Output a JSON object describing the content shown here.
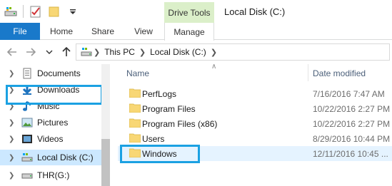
{
  "titlebar": {
    "title": "Local Disk (C:)",
    "context_tab_header": "Drive Tools",
    "qat_icons": [
      "properties-icon",
      "new-folder-icon",
      "customize-qat-icon"
    ]
  },
  "ribbon": {
    "tabs": [
      {
        "label": "File"
      },
      {
        "label": "Home"
      },
      {
        "label": "Share"
      },
      {
        "label": "View"
      },
      {
        "label": "Manage"
      }
    ]
  },
  "address": {
    "breadcrumbs": [
      "This PC",
      "Local Disk (C:)"
    ]
  },
  "sidebar": {
    "items": [
      {
        "label": "Documents",
        "icon": "documents-icon"
      },
      {
        "label": "Downloads",
        "icon": "downloads-icon"
      },
      {
        "label": "Music",
        "icon": "music-icon"
      },
      {
        "label": "Pictures",
        "icon": "pictures-icon"
      },
      {
        "label": "Videos",
        "icon": "videos-icon"
      },
      {
        "label": "Local Disk (C:)",
        "icon": "drive-icon",
        "selected": true
      },
      {
        "label": "THR(G:)",
        "icon": "drive-icon"
      }
    ]
  },
  "list": {
    "columns": {
      "name": "Name",
      "date": "Date modified"
    },
    "rows": [
      {
        "name": "PerfLogs",
        "date": "7/16/2016 7:47 AM"
      },
      {
        "name": "Program Files",
        "date": "10/22/2016 2:27 PM"
      },
      {
        "name": "Program Files (x86)",
        "date": "10/22/2016 2:27 PM"
      },
      {
        "name": "Users",
        "date": "8/29/2016 10:44 PM"
      },
      {
        "name": "Windows",
        "date": "12/11/2016 10:45 ...",
        "selected": true
      }
    ]
  },
  "colors": {
    "file_tab": "#1979ca",
    "context_tab": "#dbefc9",
    "highlight_box": "#1ba1e2",
    "selected_bg": "#cce8ff",
    "folder": "#f8d775"
  }
}
